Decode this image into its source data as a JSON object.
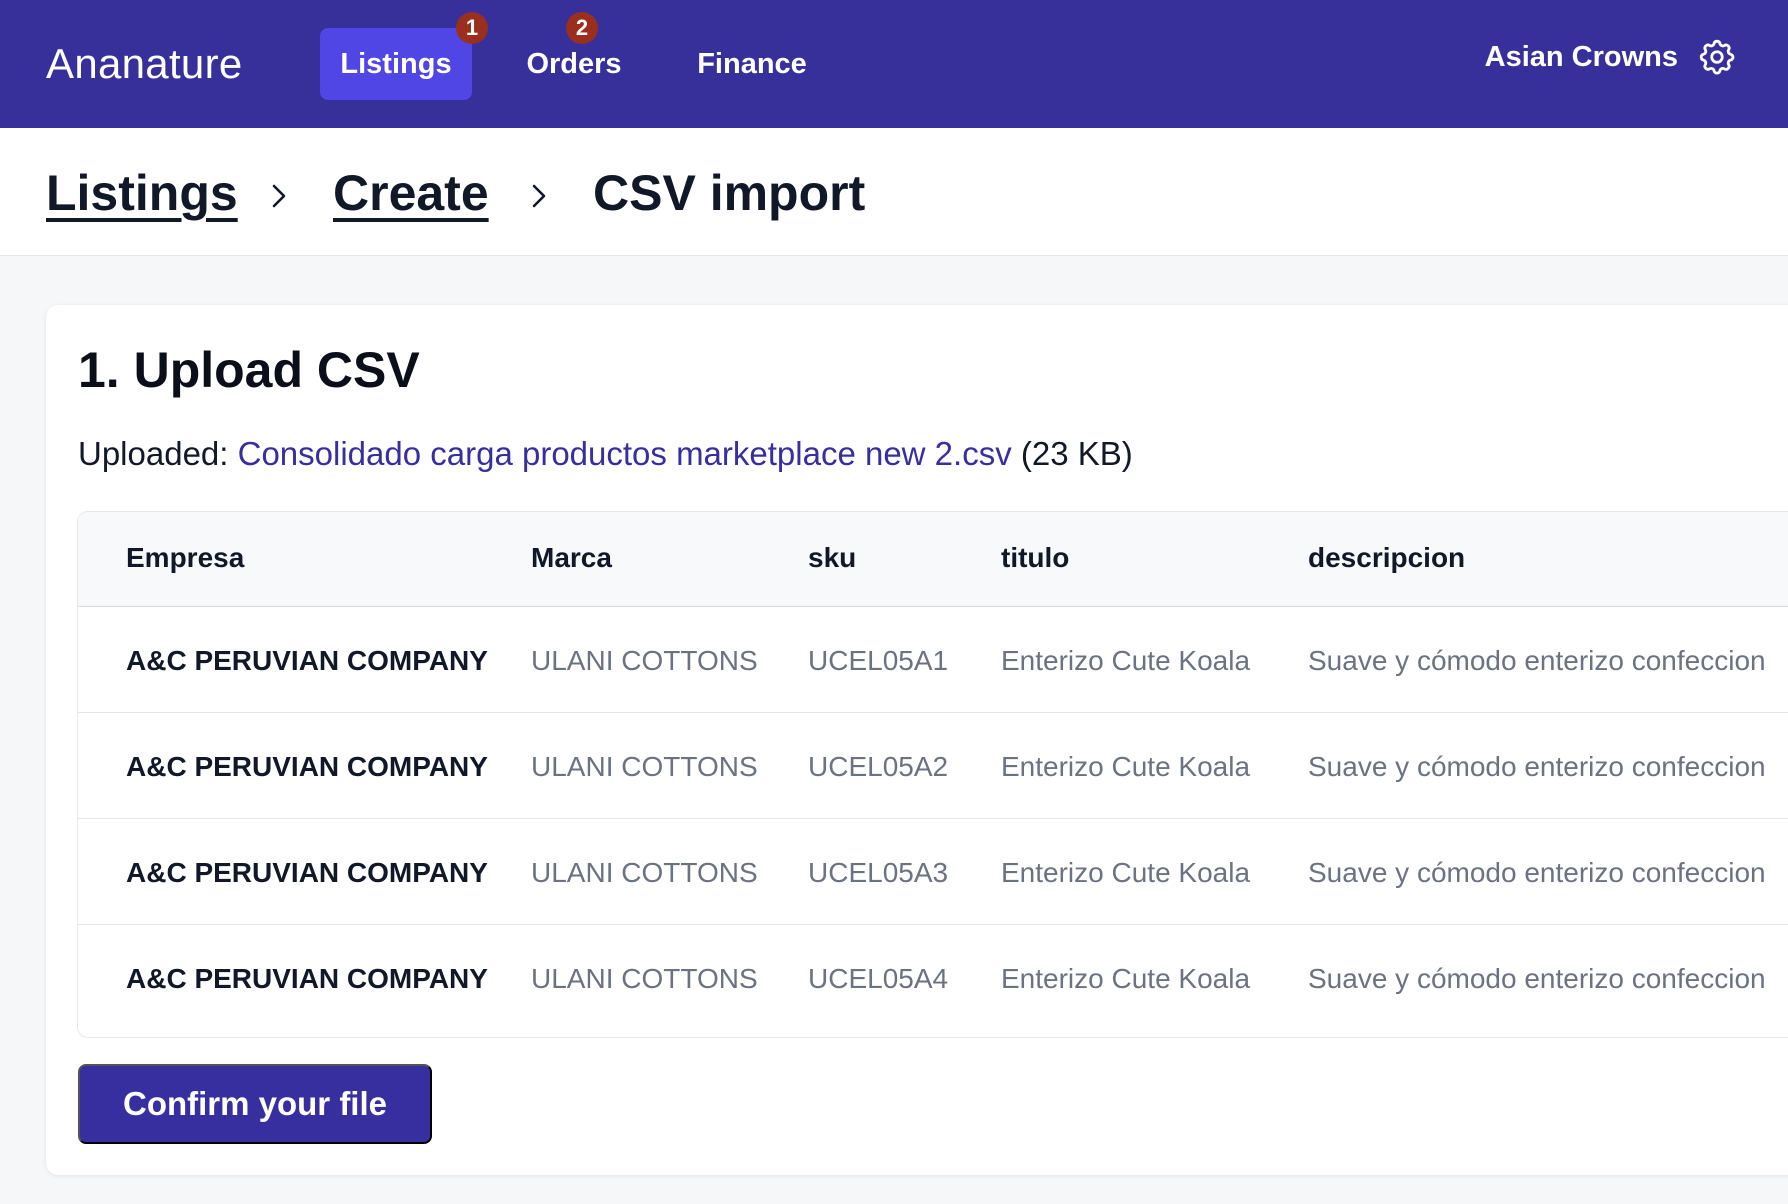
{
  "app": {
    "brand": "Ananature"
  },
  "nav": {
    "tabs": [
      {
        "label": "Listings",
        "badge": "1",
        "active": true
      },
      {
        "label": "Orders",
        "badge": "2"
      },
      {
        "label": "Finance"
      }
    ],
    "account_name": "Asian Crowns",
    "settings_icon": "gear-icon"
  },
  "breadcrumb": {
    "items": [
      "Listings",
      "Create",
      "CSV import"
    ],
    "separator_icon": "chevron-right-icon"
  },
  "upload": {
    "title": "1. Upload CSV",
    "uploaded_label": "Uploaded:",
    "file_name": "Consolidado carga productos marketplace new 2.csv",
    "file_size": "(23 KB)"
  },
  "table": {
    "headers": [
      "Empresa",
      "Marca",
      "sku",
      "titulo",
      "descripcion"
    ],
    "rows": [
      [
        "A&C PERUVIAN COMPANY",
        "ULANI COTTONS",
        "UCEL05A1",
        "Enterizo Cute Koala",
        "Suave y cómodo enterizo confeccion"
      ],
      [
        "A&C PERUVIAN COMPANY",
        "ULANI COTTONS",
        "UCEL05A2",
        "Enterizo Cute Koala",
        "Suave y cómodo enterizo confeccion"
      ],
      [
        "A&C PERUVIAN COMPANY",
        "ULANI COTTONS",
        "UCEL05A3",
        "Enterizo Cute Koala",
        "Suave y cómodo enterizo confeccion"
      ],
      [
        "A&C PERUVIAN COMPANY",
        "ULANI COTTONS",
        "UCEL05A4",
        "Enterizo Cute Koala",
        "Suave y cómodo enterizo confeccion"
      ]
    ]
  },
  "actions": {
    "confirm_label": "Confirm your file"
  },
  "colors": {
    "nav_bg": "#37309b",
    "active_tab": "#4f46e5",
    "badge": "#9a2f1e",
    "link": "#372ea0",
    "button": "#372ea0"
  }
}
